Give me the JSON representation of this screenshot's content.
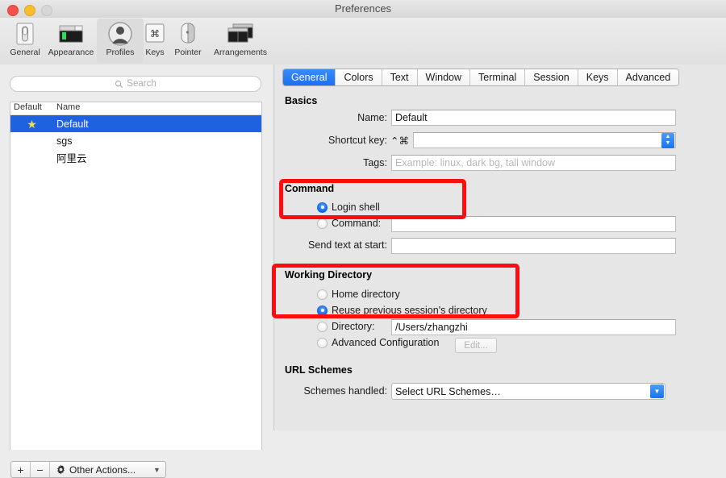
{
  "window": {
    "title": "Preferences",
    "controls": [
      "close",
      "minimize",
      "zoom"
    ]
  },
  "toolbar": {
    "items": [
      {
        "label": "General",
        "icon": "general-switch-icon",
        "selected": false
      },
      {
        "label": "Appearance",
        "icon": "appearance-window-icon",
        "selected": false
      },
      {
        "label": "Profiles",
        "icon": "profiles-person-icon",
        "selected": true
      },
      {
        "label": "Keys",
        "icon": "keys-command-key-icon",
        "selected": false
      },
      {
        "label": "Pointer",
        "icon": "pointer-mouse-icon",
        "selected": false
      },
      {
        "label": "Arrangements",
        "icon": "arrangements-windows-icon",
        "selected": false
      }
    ]
  },
  "sidebar": {
    "search": {
      "placeholder": "Search",
      "value": ""
    },
    "columns": {
      "default": "Default",
      "name": "Name"
    },
    "profiles": [
      {
        "name": "Default",
        "is_default": true,
        "selected": true,
        "star": "★"
      },
      {
        "name": "sgs",
        "is_default": false,
        "selected": false,
        "star": ""
      },
      {
        "name": "阿里云",
        "is_default": false,
        "selected": false,
        "star": ""
      }
    ],
    "bottom_bar": {
      "add_label": "+",
      "remove_label": "−",
      "other_actions_label": "Other Actions...",
      "gear_icon": "gear-icon",
      "chevron": "⌄"
    }
  },
  "tabs": [
    {
      "label": "General",
      "active": true
    },
    {
      "label": "Colors",
      "active": false
    },
    {
      "label": "Text",
      "active": false
    },
    {
      "label": "Window",
      "active": false
    },
    {
      "label": "Terminal",
      "active": false
    },
    {
      "label": "Session",
      "active": false
    },
    {
      "label": "Keys",
      "active": false
    },
    {
      "label": "Advanced",
      "active": false
    }
  ],
  "general": {
    "basics": {
      "title": "Basics",
      "name_label": "Name:",
      "name_value": "Default",
      "shortcut_label": "Shortcut key:",
      "shortcut_modifiers": "⌃⌘",
      "shortcut_value": "",
      "tags_label": "Tags:",
      "tags_placeholder": "Example: linux, dark bg, tall window",
      "tags_value": ""
    },
    "command": {
      "title": "Command",
      "login_shell_label": "Login shell",
      "login_shell_selected": true,
      "command_label": "Command:",
      "command_selected": false,
      "command_value": "",
      "send_text_label": "Send text at start:",
      "send_text_value": ""
    },
    "working_directory": {
      "title": "Working Directory",
      "home_label": "Home directory",
      "home_selected": false,
      "reuse_label": "Reuse previous session's directory",
      "reuse_selected": true,
      "directory_label": "Directory:",
      "directory_selected": false,
      "directory_value": "/Users/zhangzhi",
      "advanced_label": "Advanced Configuration",
      "advanced_selected": false,
      "edit_button_label": "Edit..."
    },
    "url_schemes": {
      "title": "URL Schemes",
      "schemes_label": "Schemes handled:",
      "schemes_value": "Select URL Schemes…"
    }
  },
  "annotations": {
    "color": "#fb0d10",
    "boxes": [
      {
        "name": "command-section-highlight"
      },
      {
        "name": "working-directory-highlight"
      }
    ]
  }
}
